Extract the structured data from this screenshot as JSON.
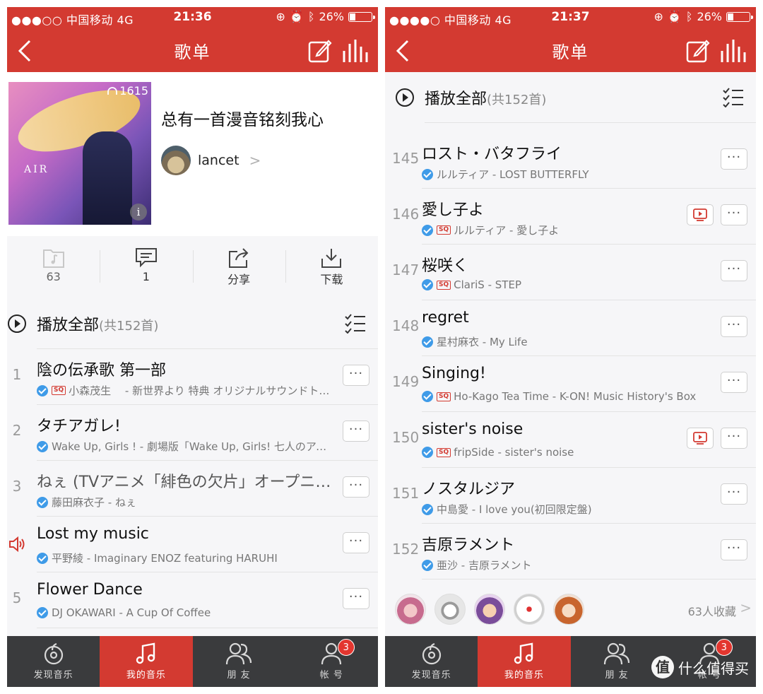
{
  "left": {
    "status": {
      "carrier": "●●●○○ 中国移动  4G",
      "time": "21:36",
      "battery": "26%"
    },
    "nav": {
      "title": "歌单"
    },
    "playlist": {
      "name": "总有一首漫音铭刻我心",
      "creator": "lancet",
      "play_count": "1615",
      "cover_text": "AIR"
    },
    "actions": [
      {
        "label": "63",
        "icon": "favorite-folder-icon"
      },
      {
        "label": "1",
        "icon": "comment-icon"
      },
      {
        "label": "分享",
        "icon": "share-icon"
      },
      {
        "label": "下载",
        "icon": "download-icon"
      }
    ],
    "play_all": {
      "label": "播放全部",
      "count": "(共152首)"
    },
    "songs": [
      {
        "index": "1",
        "title": "陰の伝承歌 第一部",
        "subtitle": "小森茂生　 - 新世界より 特典 オリジナルサウンドトラック",
        "sq": true,
        "playing": false
      },
      {
        "index": "2",
        "title": "タチアガレ!",
        "subtitle": "Wake Up, Girls ! - 劇場版「Wake Up, Girls! 七人のアイドル」",
        "sq": false,
        "playing": false
      },
      {
        "index": "3",
        "title": "ねぇ (TVアニメ「緋色の欠片」オープニング)",
        "subtitle": "藤田麻衣子 - ねぇ",
        "sq": false,
        "playing": false
      },
      {
        "index": "",
        "title": "Lost my music",
        "subtitle": "平野綾 - Imaginary ENOZ featuring HARUHI",
        "sq": false,
        "playing": true
      },
      {
        "index": "5",
        "title": "Flower Dance",
        "subtitle": "DJ OKAWARI - A Cup Of Coffee",
        "sq": false,
        "playing": false
      }
    ]
  },
  "right": {
    "status": {
      "carrier": "●●●●○ 中国移动  4G",
      "time": "21:37",
      "battery": "26%"
    },
    "nav": {
      "title": "歌单"
    },
    "play_all": {
      "label": "播放全部",
      "count": "(共152首)"
    },
    "songs": [
      {
        "index": "145",
        "title": "ロスト・バタフライ",
        "subtitle": "ルルティア - LOST BUTTERFLY",
        "sq": false,
        "mv": false
      },
      {
        "index": "146",
        "title": "愛し子よ",
        "subtitle": "ルルティア - 愛し子よ",
        "sq": true,
        "mv": true
      },
      {
        "index": "147",
        "title": "桜咲く",
        "subtitle": "ClariS - STEP",
        "sq": true,
        "mv": false
      },
      {
        "index": "148",
        "title": "regret",
        "subtitle": "星村麻衣 - My Life",
        "sq": false,
        "mv": false
      },
      {
        "index": "149",
        "title": "Singing!",
        "subtitle": "Ho-Kago Tea Time - K-ON! Music History's Box",
        "sq": true,
        "mv": false
      },
      {
        "index": "150",
        "title": "sister's noise",
        "subtitle": "fripSide - sister's noise",
        "sq": true,
        "mv": true
      },
      {
        "index": "151",
        "title": "ノスタルジア",
        "subtitle": "中島愛 - I love you(初回限定盤)",
        "sq": false,
        "mv": false
      },
      {
        "index": "152",
        "title": "吉原ラメント",
        "subtitle": "亜沙 - 吉原ラメント",
        "sq": false,
        "mv": false
      }
    ],
    "collectors": {
      "count_label": "63人收藏"
    }
  },
  "tabs": [
    {
      "label": "发现音乐",
      "icon": "discover-music-icon"
    },
    {
      "label": "我的音乐",
      "icon": "my-music-icon",
      "active": true
    },
    {
      "label": "朋 友",
      "icon": "friends-icon"
    },
    {
      "label": "帐 号",
      "icon": "account-icon",
      "badge": "3"
    }
  ],
  "sq_label": "SQ",
  "more_label": "···",
  "watermark": {
    "logo": "值",
    "text": "什么值得买"
  },
  "colors": {
    "brand_red": "#d33a31",
    "tabbar_dark": "#3a3b3d",
    "verified_blue": "#3f9be8"
  }
}
